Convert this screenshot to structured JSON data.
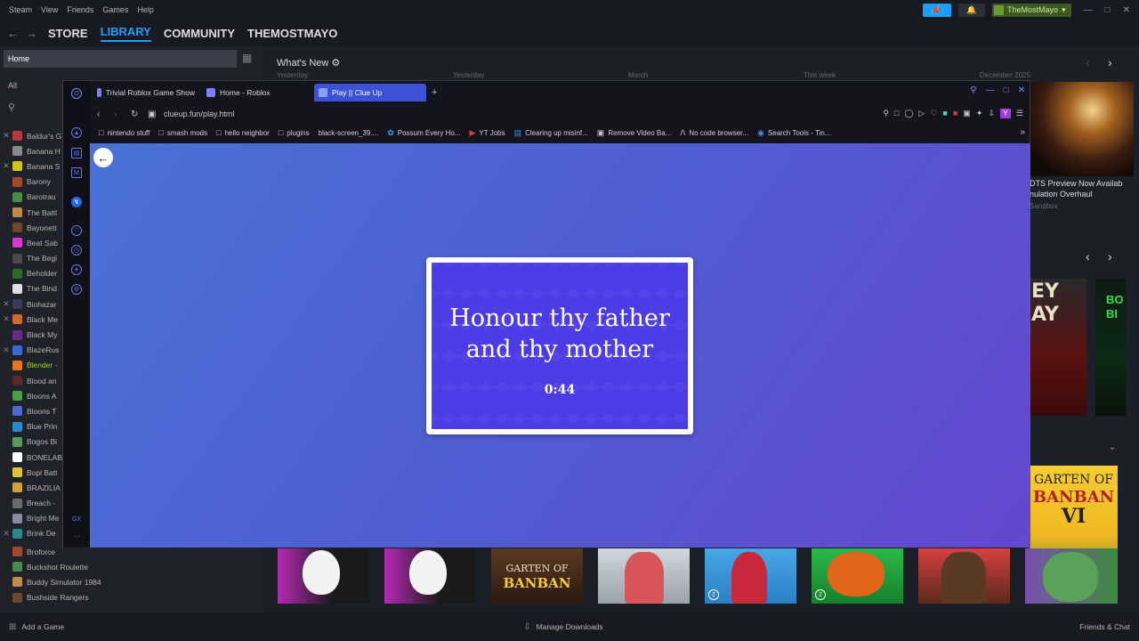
{
  "steam": {
    "menu": [
      "Steam",
      "View",
      "Friends",
      "Games",
      "Help"
    ],
    "username": "TheMostMayo",
    "nav": {
      "store": "STORE",
      "library": "LIBRARY",
      "community": "COMMUNITY",
      "profile": "THEMOSTMAYO"
    },
    "library": {
      "home": "Home",
      "all": "All",
      "games": [
        "Baldur's G",
        "Banana H",
        "Banana S",
        "Barony",
        "Barotrau",
        "The Battl",
        "Bayonett",
        "Beat Sab",
        "The Begi",
        "Beholder",
        "The Bind",
        "Biohazar",
        "Black Me",
        "Black My",
        "BlazeRus",
        "Blender -",
        "Blood an",
        "Bloons A",
        "Bloons T",
        "Blue Prin",
        "Bogos Bi",
        "BONELAB",
        "Bopl Batt",
        "BRAZILIA",
        "Breach -",
        "Bright Me",
        "Brink De"
      ],
      "games_lower": [
        "Broforce",
        "Buckshot Roulette",
        "Buddy Simulator 1984",
        "Bushside Rangers"
      ]
    },
    "whats_new": {
      "title": "What's New",
      "dates": [
        "Yesterday",
        "Yesterday",
        "March",
        "This week",
        "December 2025"
      ]
    },
    "news": {
      "title_line1": "DTS Preview Now Availab",
      "title_line2": "nulation Overhaul",
      "tag": "Sandbox"
    },
    "bottom": {
      "add_game": "Add a Game",
      "downloads": "Manage Downloads",
      "friends": "Friends & Chat"
    }
  },
  "browser": {
    "tabs": [
      "Trivial Roblox Game Show",
      "Home - Roblox",
      "Play || Clue Up"
    ],
    "url": "clueup.fun/play.html",
    "bookmarks": [
      "nintendo stuff",
      "smash mods",
      "hello neighbor",
      "plugins",
      "black-screen_39....",
      "Possum Every Ho...",
      "YT Jobs",
      "Clearing up misinf...",
      "Remove Video Ba...",
      "No code browser...",
      "Search Tools - Tin..."
    ],
    "ext_y": "Y"
  },
  "game": {
    "clue": "Honour thy father and thy mother",
    "timer": "0:44"
  },
  "colors": {
    "steam_accent": "#1a9fff",
    "browser_accent": "#3b52d6",
    "card_bg": "#4b3ce6"
  },
  "icons": [
    "steam-logo-icon",
    "back-arrow-icon",
    "reload-icon",
    "lock-icon",
    "folder-icon",
    "search-icon",
    "close-icon",
    "bell-icon",
    "megaphone-icon"
  ]
}
